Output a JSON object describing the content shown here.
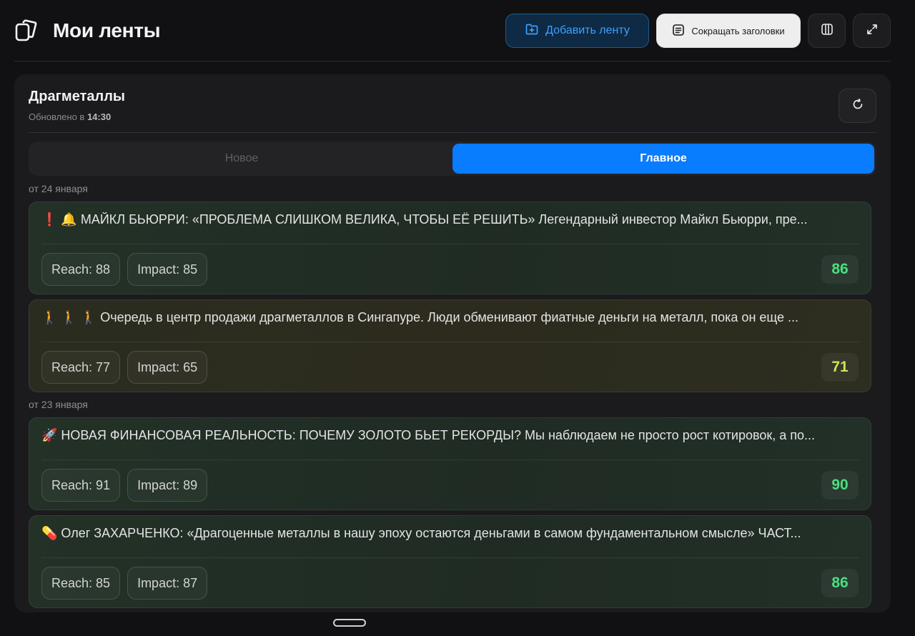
{
  "header": {
    "title": "Мои ленты",
    "add_feed_label": "Добавить ленту",
    "shorten_titles_label": "Сокращать заголовки"
  },
  "feed": {
    "title": "Драгметаллы",
    "updated_prefix": "Обновлено в",
    "updated_time": "14:30"
  },
  "tabs": [
    {
      "label": "Новое",
      "active": false
    },
    {
      "label": "Главное",
      "active": true
    }
  ],
  "groups": [
    {
      "date_label": "от 24 января"
    },
    {
      "date_label": "от 23 января"
    }
  ],
  "cards": [
    {
      "text": "❗ 🔔 МАЙКЛ БЬЮРРИ: «ПРОБЛЕМА СЛИШКОМ ВЕЛИКА, ЧТОБЫ ЕЁ РЕШИТЬ» Легендарный инвестор Майкл Бьюрри, пре...",
      "reach": "Reach: 88",
      "impact": "Impact: 85",
      "score": "86",
      "score_color": "#4ade80",
      "tone": "green"
    },
    {
      "text": "🚶 🚶 🚶 Очередь в центр продажи драгметаллов в Сингапуре. Люди обменивают фиатные деньги на металл, пока он еще ...",
      "reach": "Reach: 77",
      "impact": "Impact: 65",
      "score": "71",
      "score_color": "#d4e157",
      "tone": "yellow"
    },
    {
      "text": "🚀 НОВАЯ ФИНАНСОВАЯ РЕАЛЬНОСТЬ: ПОЧЕМУ ЗОЛОТО БЬЕТ РЕКОРДЫ? Мы наблюдаем не просто рост котировок, а по...",
      "reach": "Reach: 91",
      "impact": "Impact: 89",
      "score": "90",
      "score_color": "#4ade80",
      "tone": "green"
    },
    {
      "text": "💊 Олег ЗАХАРЧЕНКО: «Драгоценные металлы в нашу эпоху остаются деньгами в самом фундаментальном смысле» ЧАСТ...",
      "reach": "Reach: 85",
      "impact": "Impact: 87",
      "score": "86",
      "score_color": "#4ade80",
      "tone": "green"
    }
  ],
  "icons": {
    "logo": "stacked-cards-icon",
    "add": "folder-plus-icon",
    "shorten": "text-lines-icon",
    "columns": "columns-icon",
    "expand": "expand-icon",
    "refresh": "refresh-icon"
  }
}
